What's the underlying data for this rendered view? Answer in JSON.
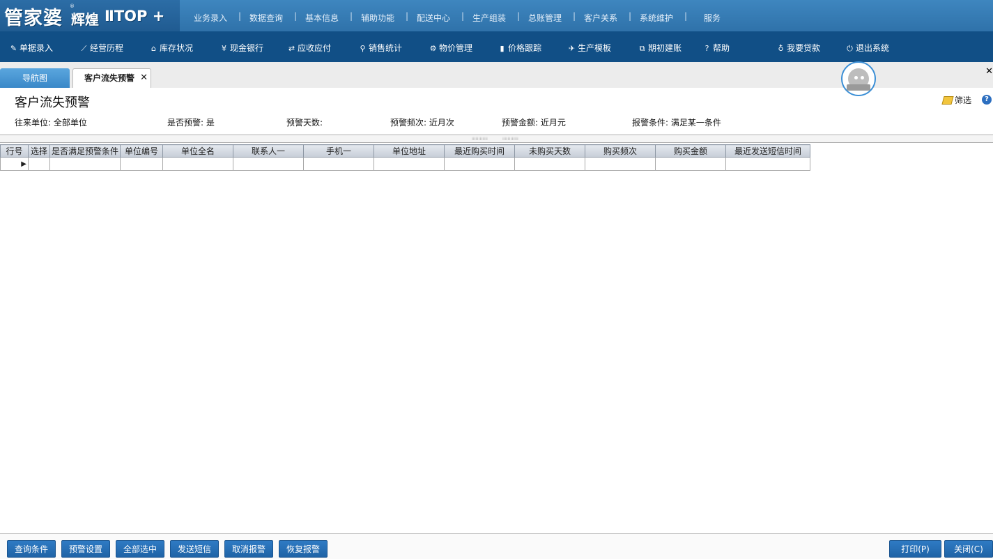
{
  "logo": {
    "brand": "管家婆",
    "edition": "辉煌",
    "version": "ⅡTOP +",
    "tm": "®"
  },
  "top_menu": [
    "业务录入",
    "数据查询",
    "基本信息",
    "辅助功能",
    "配送中心",
    "生产组装",
    "总账管理",
    "客户关系",
    "系统维护",
    "服务"
  ],
  "toolbar": [
    {
      "label": "单据录入",
      "icon": "document-icon",
      "glyph": "✎"
    },
    {
      "label": "经营历程",
      "icon": "chart-line-icon",
      "glyph": "⟋"
    },
    {
      "label": "库存状况",
      "icon": "home-icon",
      "glyph": "⌂"
    },
    {
      "label": "现金银行",
      "icon": "yen-icon",
      "glyph": "¥"
    },
    {
      "label": "应收应付",
      "icon": "exchange-icon",
      "glyph": "⇄"
    },
    {
      "label": "销售统计",
      "icon": "search-icon",
      "glyph": "⚲"
    },
    {
      "label": "物价管理",
      "icon": "gear-icon",
      "glyph": "⚙"
    },
    {
      "label": "价格跟踪",
      "icon": "bar-chart-icon",
      "glyph": "▮"
    },
    {
      "label": "生产模板",
      "icon": "wrench-icon",
      "glyph": "✈"
    },
    {
      "label": "期初建账",
      "icon": "external-link-icon",
      "glyph": "⧉"
    },
    {
      "label": "帮助",
      "icon": "question-icon",
      "glyph": "?"
    },
    {
      "label": "我要贷款",
      "icon": "money-bag-icon",
      "glyph": "♁"
    },
    {
      "label": "退出系统",
      "icon": "power-icon",
      "glyph": "⏻"
    }
  ],
  "tabs": {
    "nav": "导航图",
    "active": "客户流失预警",
    "close_glyph": "✕"
  },
  "page": {
    "title": "客户流失预警",
    "filter_label": "筛选",
    "help_glyph": "?"
  },
  "conditions": [
    {
      "label": "往来单位:",
      "value": "全部单位"
    },
    {
      "label": "是否预警:",
      "value": "是"
    },
    {
      "label": "预警天数:",
      "value": ""
    },
    {
      "label": "预警频次:",
      "value": "近月次"
    },
    {
      "label": "预警金额:",
      "value": "近月元"
    },
    {
      "label": "报警条件:",
      "value": "满足某一条件"
    }
  ],
  "grid": {
    "columns": [
      "行号",
      "选择",
      "是否满足预警条件",
      "单位编号",
      "单位全名",
      "联系人一",
      "手机一",
      "单位地址",
      "最近购买时间",
      "未购买天数",
      "购买频次",
      "购买金额",
      "最近发送短信时间"
    ],
    "rows": [
      {
        "marker": "▶"
      }
    ]
  },
  "bottom_buttons": {
    "left": [
      "查询条件",
      "预警设置",
      "全部选中",
      "发送短信",
      "取消报警",
      "恢复报警"
    ],
    "right": [
      "打印(P)",
      "关闭(C)"
    ]
  },
  "colors": {
    "topbar": "#3e86bf",
    "toolbar": "#114f86",
    "button": "#2f7bc4"
  }
}
